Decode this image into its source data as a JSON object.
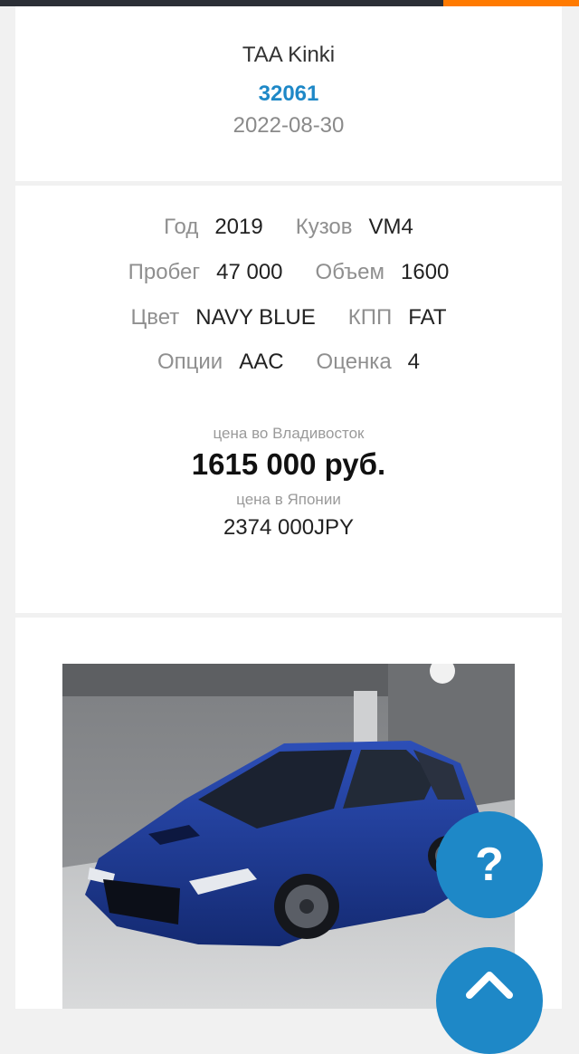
{
  "auction": {
    "name": "TAA Kinki",
    "lot_number": "32061",
    "date": "2022-08-30"
  },
  "specs": {
    "rows": [
      {
        "left_label": "Год",
        "left_value": "2019",
        "right_label": "Кузов",
        "right_value": "VM4"
      },
      {
        "left_label": "Пробег",
        "left_value": "47 000",
        "right_label": "Объем",
        "right_value": "1600"
      },
      {
        "left_label": "Цвет",
        "left_value": "NAVY BLUE",
        "right_label": "КПП",
        "right_value": "FAT"
      },
      {
        "left_label": "Опции",
        "left_value": "AAC",
        "right_label": "Оценка",
        "right_value": "4"
      }
    ]
  },
  "price": {
    "vladivostok_caption": "цена во Владивосток",
    "vladivostok_value": "1615 000 руб.",
    "japan_caption": "цена в Японии",
    "japan_value": "2374 000JPY"
  },
  "photo": {
    "car_color": "#1f3a8f"
  },
  "buttons": {
    "help_label": "?",
    "help_icon": "question-icon",
    "up_icon": "chevron-up-icon"
  },
  "colors": {
    "accent": "#1e88c7",
    "topbar": "#2b2f36",
    "topbar_accent": "#ff7a00"
  }
}
